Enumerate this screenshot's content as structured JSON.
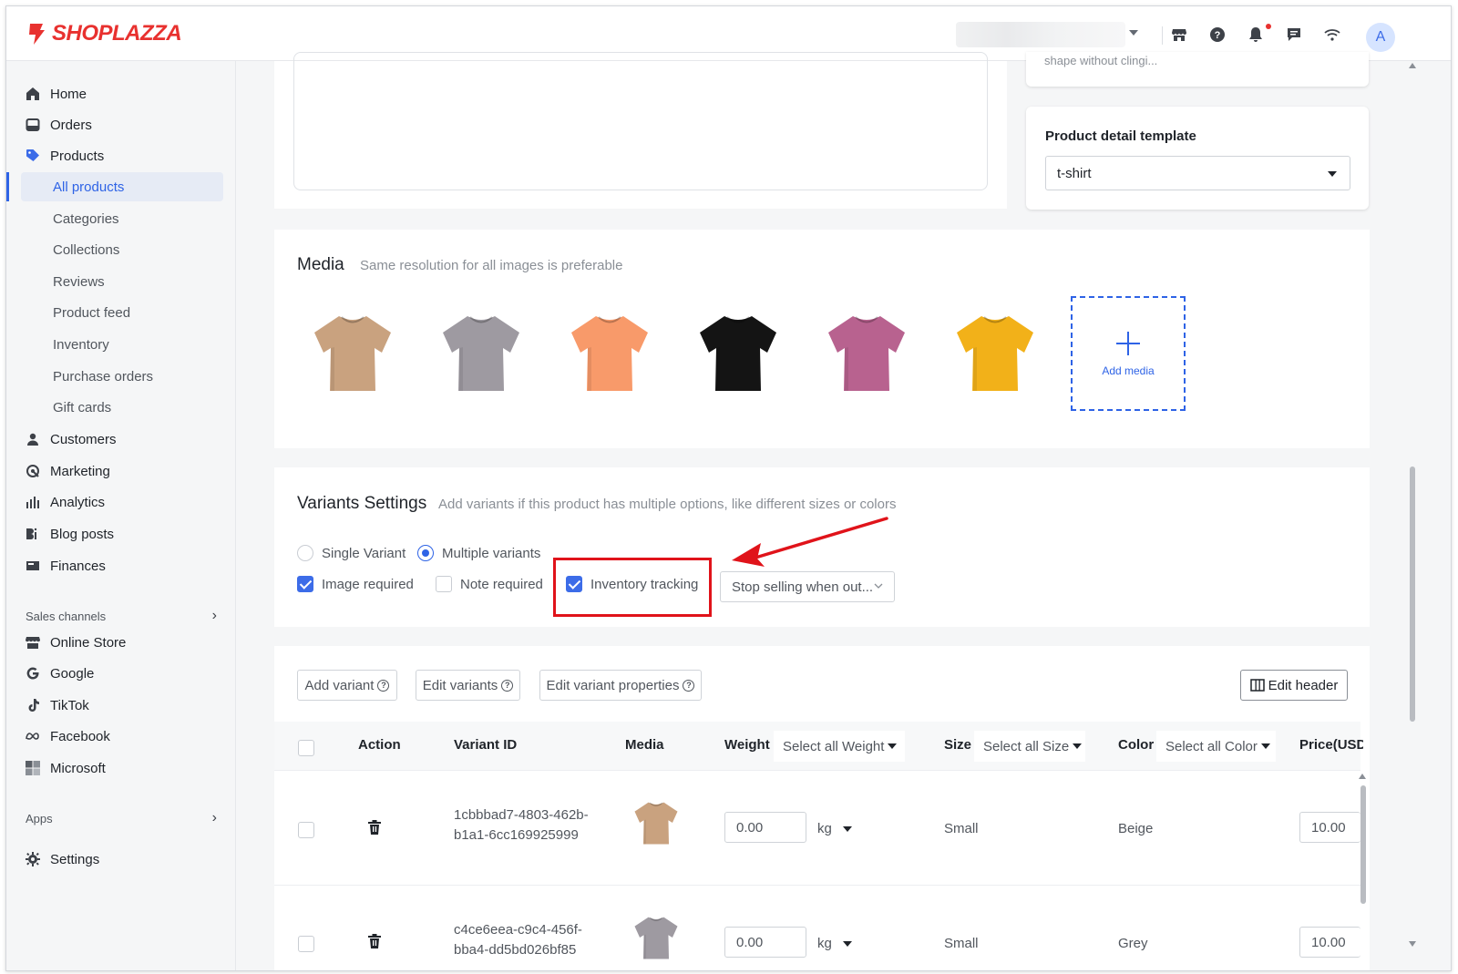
{
  "brand": {
    "name": "SHOPLAZZA",
    "color": "#e8312f"
  },
  "header": {
    "avatar_initial": "A",
    "icons": [
      "store-icon",
      "help-icon",
      "bell-icon",
      "chat-icon",
      "wifi-icon"
    ]
  },
  "sidebar": {
    "items": [
      {
        "label": "Home",
        "icon": "home-icon"
      },
      {
        "label": "Orders",
        "icon": "orders-icon"
      },
      {
        "label": "Products",
        "icon": "tag-icon"
      }
    ],
    "product_subitems": [
      "All products",
      "Categories",
      "Collections",
      "Reviews",
      "Product feed",
      "Inventory",
      "Purchase orders",
      "Gift cards"
    ],
    "items_after": [
      {
        "label": "Customers",
        "icon": "person-icon"
      },
      {
        "label": "Marketing",
        "icon": "marketing-icon"
      },
      {
        "label": "Analytics",
        "icon": "analytics-icon"
      },
      {
        "label": "Blog posts",
        "icon": "blog-icon"
      },
      {
        "label": "Finances",
        "icon": "finances-icon"
      }
    ],
    "sales_channels_label": "Sales channels",
    "channels": [
      {
        "label": "Online Store",
        "icon": "store-icon"
      },
      {
        "label": "Google",
        "icon": "google-icon"
      },
      {
        "label": "TikTok",
        "icon": "tiktok-icon"
      },
      {
        "label": "Facebook",
        "icon": "meta-icon"
      },
      {
        "label": "Microsoft",
        "icon": "microsoft-icon"
      }
    ],
    "apps_label": "Apps",
    "settings_label": "Settings"
  },
  "top_right_card": {
    "truncated_text": "shape without clingi..."
  },
  "template_card": {
    "title": "Product detail template",
    "selected": "t-shirt"
  },
  "media": {
    "title": "Media",
    "hint": "Same resolution for all images is preferable",
    "add_label": "Add media",
    "shirt_colors": [
      "#c9a27f",
      "#9e9aa1",
      "#f89a6a",
      "#141414",
      "#b8628f",
      "#f2b119"
    ]
  },
  "variants": {
    "title": "Variants Settings",
    "hint": "Add variants if this product has multiple options, like different sizes or colors",
    "single_label": "Single Variant",
    "multiple_label": "Multiple variants",
    "image_required_label": "Image required",
    "note_required_label": "Note required",
    "inventory_tracking_label": "Inventory tracking",
    "stop_selling_label": "Stop selling when out...",
    "annotation_color": "#e0131a"
  },
  "toolbar": {
    "add_variant": "Add variant",
    "edit_variants": "Edit variants",
    "edit_properties": "Edit variant properties",
    "edit_header": "Edit header"
  },
  "table": {
    "headers": {
      "action": "Action",
      "variant_id": "Variant ID",
      "media": "Media",
      "weight": "Weight",
      "weight_select": "Select all Weight",
      "size": "Size",
      "size_select": "Select all Size",
      "color": "Color",
      "color_select": "Select all Color",
      "price": "Price(USD)"
    },
    "rows": [
      {
        "id_line1": "1cbbbad7-4803-462b-",
        "id_line2": "b1a1-6cc169925999",
        "weight": "0.00",
        "unit": "kg",
        "size": "Small",
        "color": "Beige",
        "price": "10.00",
        "shirt": "#c9a27f"
      },
      {
        "id_line1": "c4ce6eea-c9c4-456f-",
        "id_line2": "bba4-dd5bd026bf85",
        "weight": "0.00",
        "unit": "kg",
        "size": "Small",
        "color": "Grey",
        "price": "10.00",
        "shirt": "#9e9aa1"
      }
    ]
  }
}
